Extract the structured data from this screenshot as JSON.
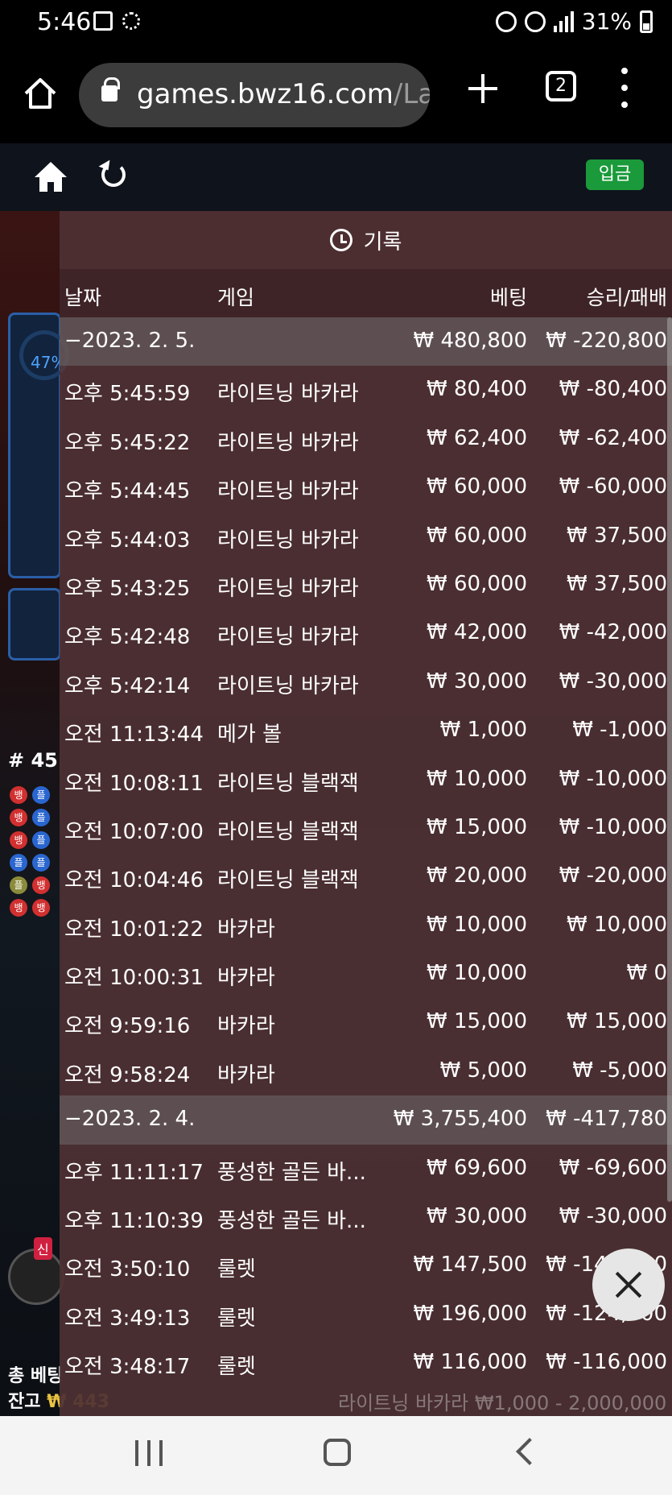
{
  "status_bar": {
    "time": "5:46",
    "battery": "31%",
    "icons": [
      "gallery-icon",
      "weather-icon",
      "alarm-icon",
      "mute-icon",
      "hd-voice-icon",
      "lte-icon",
      "signal-icon",
      "battery-icon"
    ]
  },
  "browser": {
    "url_main": "games.bwz16.com",
    "url_rest": "/La",
    "tab_count": "2"
  },
  "site": {
    "deposit_label": "입금"
  },
  "background": {
    "progress_label": "47%",
    "round_label": "# 45",
    "new_badge": "신",
    "total_bet_label": "총 베팅",
    "balance_label": "잔고",
    "balance_value": "₩ 443",
    "footer_hint": "라이트닝 바카라 ₩1,000 - 2,000,000",
    "bead_road": [
      "뱅",
      "플",
      "뱅",
      "플",
      "뱅",
      "플",
      "플",
      "플",
      "플",
      "뱅",
      "뱅",
      "뱅"
    ]
  },
  "history": {
    "title": "기록",
    "columns": {
      "date": "날짜",
      "game": "게임",
      "bet": "베팅",
      "win_loss": "승리/패배"
    },
    "rows": [
      {
        "type": "group",
        "date": "−2023. 2. 5.",
        "game": "",
        "bet": "₩ 480,800",
        "win_loss": "₩ -220,800"
      },
      {
        "type": "item",
        "date": "오후 5:45:59",
        "game": "라이트닝 바카라",
        "bet": "₩ 80,400",
        "win_loss": "₩ -80,400"
      },
      {
        "type": "item",
        "date": "오후 5:45:22",
        "game": "라이트닝 바카라",
        "bet": "₩ 62,400",
        "win_loss": "₩ -62,400"
      },
      {
        "type": "item",
        "date": "오후 5:44:45",
        "game": "라이트닝 바카라",
        "bet": "₩ 60,000",
        "win_loss": "₩ -60,000"
      },
      {
        "type": "item",
        "date": "오후 5:44:03",
        "game": "라이트닝 바카라",
        "bet": "₩ 60,000",
        "win_loss": "₩ 37,500"
      },
      {
        "type": "item",
        "date": "오후 5:43:25",
        "game": "라이트닝 바카라",
        "bet": "₩ 60,000",
        "win_loss": "₩ 37,500"
      },
      {
        "type": "item",
        "date": "오후 5:42:48",
        "game": "라이트닝 바카라",
        "bet": "₩ 42,000",
        "win_loss": "₩ -42,000"
      },
      {
        "type": "item",
        "date": "오후 5:42:14",
        "game": "라이트닝 바카라",
        "bet": "₩ 30,000",
        "win_loss": "₩ -30,000"
      },
      {
        "type": "item",
        "date": "오전 11:13:44",
        "game": "메가 볼",
        "bet": "₩ 1,000",
        "win_loss": "₩ -1,000"
      },
      {
        "type": "item",
        "date": "오전 10:08:11",
        "game": "라이트닝 블랙잭",
        "bet": "₩ 10,000",
        "win_loss": "₩ -10,000"
      },
      {
        "type": "item",
        "date": "오전 10:07:00",
        "game": "라이트닝 블랙잭",
        "bet": "₩ 15,000",
        "win_loss": "₩ -10,000"
      },
      {
        "type": "item",
        "date": "오전 10:04:46",
        "game": "라이트닝 블랙잭",
        "bet": "₩ 20,000",
        "win_loss": "₩ -20,000"
      },
      {
        "type": "item",
        "date": "오전 10:01:22",
        "game": "바카라",
        "bet": "₩ 10,000",
        "win_loss": "₩ 10,000"
      },
      {
        "type": "item",
        "date": "오전 10:00:31",
        "game": "바카라",
        "bet": "₩ 10,000",
        "win_loss": "₩ 0"
      },
      {
        "type": "item",
        "date": "오전 9:59:16",
        "game": "바카라",
        "bet": "₩ 15,000",
        "win_loss": "₩ 15,000"
      },
      {
        "type": "item",
        "date": "오전 9:58:24",
        "game": "바카라",
        "bet": "₩ 5,000",
        "win_loss": "₩ -5,000"
      },
      {
        "type": "group",
        "date": "−2023. 2. 4.",
        "game": "",
        "bet": "₩ 3,755,400",
        "win_loss": "₩ -417,780"
      },
      {
        "type": "item",
        "date": "오후 11:11:17",
        "game": "풍성한 골든 바...",
        "bet": "₩ 69,600",
        "win_loss": "₩ -69,600"
      },
      {
        "type": "item",
        "date": "오후 11:10:39",
        "game": "풍성한 골든 바...",
        "bet": "₩ 30,000",
        "win_loss": "₩ -30,000"
      },
      {
        "type": "item",
        "date": "오전 3:50:10",
        "game": "룰렛",
        "bet": "₩ 147,500",
        "win_loss": "₩ -147,500"
      },
      {
        "type": "item",
        "date": "오전 3:49:13",
        "game": "룰렛",
        "bet": "₩ 196,000",
        "win_loss": "₩ -124,000"
      },
      {
        "type": "item",
        "date": "오전 3:48:17",
        "game": "룰렛",
        "bet": "₩ 116,000",
        "win_loss": "₩ -116,000"
      }
    ]
  }
}
